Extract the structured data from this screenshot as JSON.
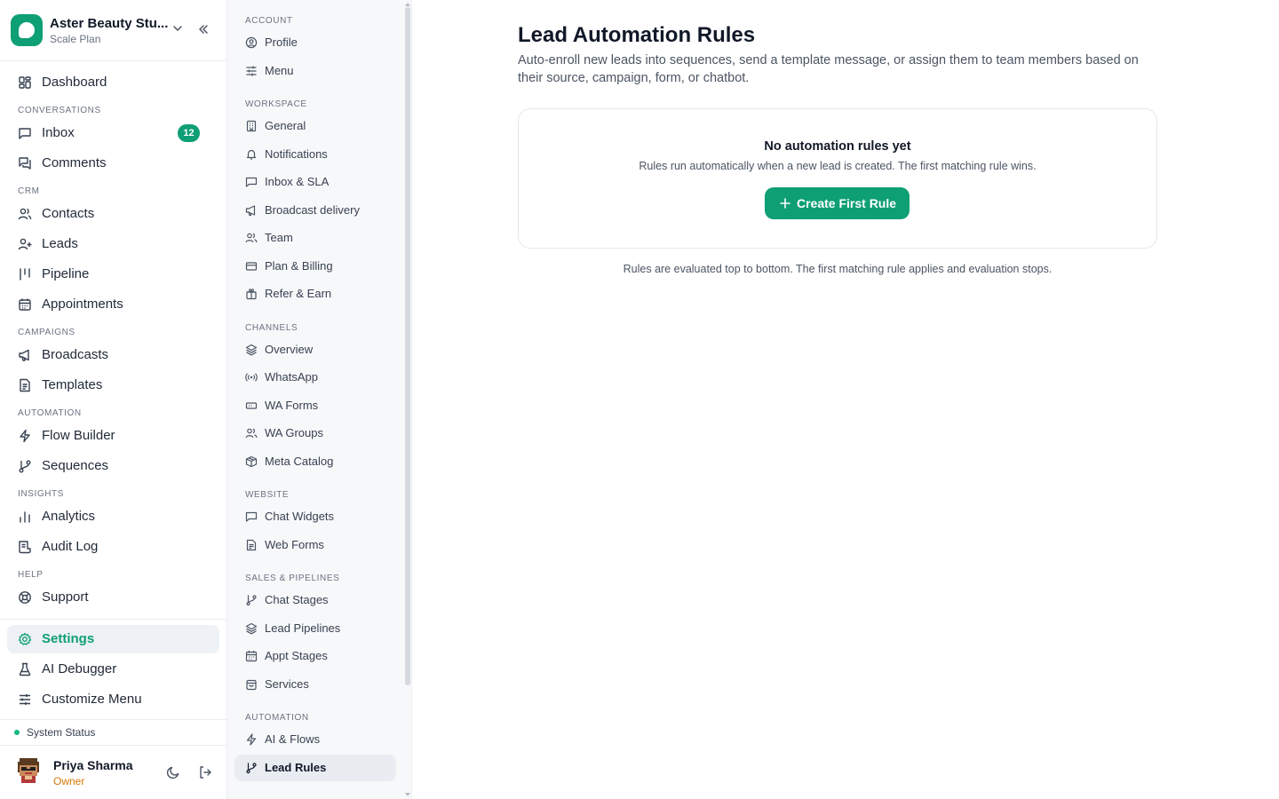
{
  "workspace": {
    "name": "Aster Beauty Stu...",
    "plan": "Scale Plan"
  },
  "sidebar": {
    "dashboard": "Dashboard",
    "sections": {
      "conversations": "CONVERSATIONS",
      "crm": "CRM",
      "campaigns": "CAMPAIGNS",
      "automation": "AUTOMATION",
      "insights": "INSIGHTS",
      "help": "HELP"
    },
    "inbox": "Inbox",
    "inbox_badge": "12",
    "comments": "Comments",
    "contacts": "Contacts",
    "leads": "Leads",
    "pipeline": "Pipeline",
    "appointments": "Appointments",
    "broadcasts": "Broadcasts",
    "templates": "Templates",
    "flow_builder": "Flow Builder",
    "sequences": "Sequences",
    "analytics": "Analytics",
    "audit_log": "Audit Log",
    "support": "Support",
    "settings": "Settings",
    "ai_debugger": "AI Debugger",
    "customize_menu": "Customize Menu",
    "system_status": "System Status"
  },
  "user": {
    "name": "Priya Sharma",
    "role": "Owner"
  },
  "subnav": {
    "sections": {
      "account": "ACCOUNT",
      "workspace": "WORKSPACE",
      "channels": "CHANNELS",
      "website": "WEBSITE",
      "sales": "SALES & PIPELINES",
      "automation": "AUTOMATION"
    },
    "profile": "Profile",
    "menu": "Menu",
    "general": "General",
    "notifications": "Notifications",
    "inbox_sla": "Inbox & SLA",
    "broadcast_delivery": "Broadcast delivery",
    "team": "Team",
    "plan_billing": "Plan & Billing",
    "refer_earn": "Refer & Earn",
    "overview": "Overview",
    "whatsapp": "WhatsApp",
    "wa_forms": "WA Forms",
    "wa_groups": "WA Groups",
    "meta_catalog": "Meta Catalog",
    "chat_widgets": "Chat Widgets",
    "web_forms": "Web Forms",
    "chat_stages": "Chat Stages",
    "lead_pipelines": "Lead Pipelines",
    "appt_stages": "Appt Stages",
    "services": "Services",
    "ai_flows": "AI & Flows",
    "lead_rules": "Lead Rules"
  },
  "main": {
    "title": "Lead Automation Rules",
    "description": "Auto-enroll new leads into sequences, send a template message, or assign them to team members based on their source, campaign, form, or chatbot.",
    "empty_title": "No automation rules yet",
    "empty_subtitle": "Rules run automatically when a new lead is created. The first matching rule wins.",
    "create_button": "Create First Rule",
    "footnote": "Rules are evaluated top to bottom. The first matching rule applies and evaluation stops."
  },
  "colors": {
    "accent": "#0f9f75",
    "owner_role": "#d97706",
    "status_ok": "#10b981"
  }
}
